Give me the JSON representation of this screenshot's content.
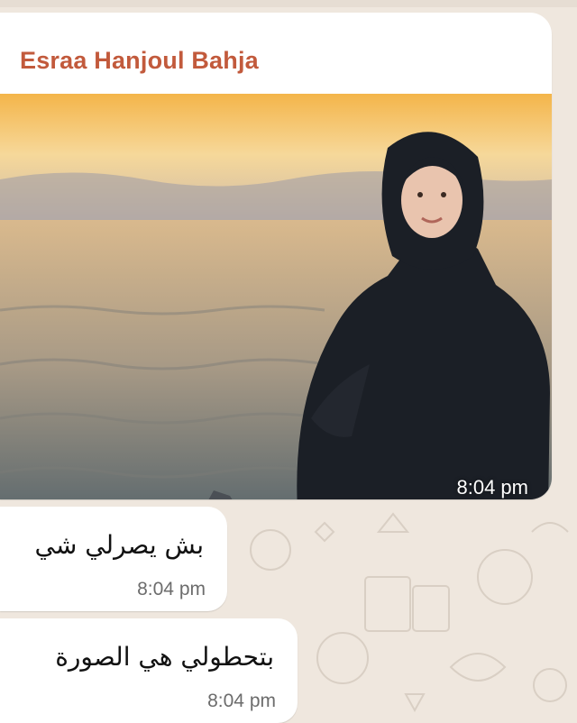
{
  "chat": {
    "sender_name": "Esraa Hanjoul Bahja",
    "image_time": "8:04 pm",
    "messages": [
      {
        "text": "بش يصرلي شي",
        "time": "8:04 pm"
      },
      {
        "text": "بتحطولي هي الصورة",
        "time": "8:04 pm"
      }
    ]
  },
  "colors": {
    "chat_background": "#efe7de",
    "bubble": "#ffffff",
    "sender_name": "#c25a3c"
  }
}
